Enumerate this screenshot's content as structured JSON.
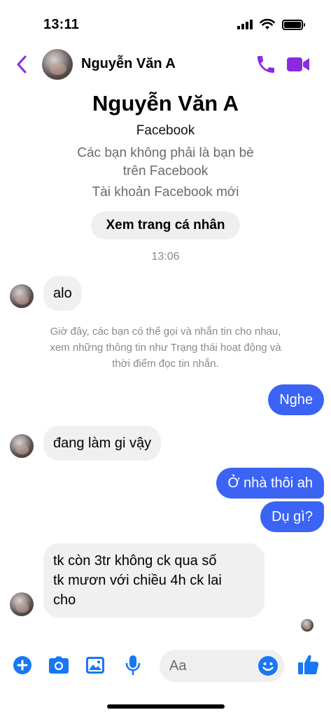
{
  "status_bar": {
    "time": "13:11"
  },
  "header": {
    "contact_name": "Nguyễn Văn A",
    "accent_color": "#8a2be2"
  },
  "profile": {
    "name": "Nguyễn Văn A",
    "platform": "Facebook",
    "friend_note_line1": "Các bạn không phải là bạn bè",
    "friend_note_line2": "trên Facebook",
    "account_note": "Tài khoản Facebook mới",
    "view_profile_label": "Xem trang cá nhân"
  },
  "conversation": {
    "timestamp": "13:06",
    "system_note_line1": "Giờ đây, các bạn có thể gọi và nhắn tin cho nhau,",
    "system_note_line2": "xem những thông tin như Trạng thái hoạt động và",
    "system_note_line3": "thời điểm đọc tin nhắn.",
    "messages": [
      {
        "from": "contact",
        "text": "alo"
      },
      {
        "from": "me",
        "text": "Nghe"
      },
      {
        "from": "contact",
        "text": "đang làm gi vậy"
      },
      {
        "from": "me",
        "text": "Ở nhà thôi ah"
      },
      {
        "from": "me",
        "text": "Dụ gì?"
      },
      {
        "from": "contact",
        "lines": [
          "tk còn 3tr không ck qua số",
          "tk mươn với chiều 4h ck lai",
          "cho"
        ]
      }
    ],
    "outgoing_color": "#3b64f5",
    "incoming_color": "#f0f0f0"
  },
  "composer": {
    "placeholder": "Aa",
    "icon_color": "#1877f2",
    "icons": [
      "plus-icon",
      "camera-icon",
      "image-icon",
      "microphone-icon",
      "emoji-icon",
      "thumbs-up-icon"
    ]
  }
}
